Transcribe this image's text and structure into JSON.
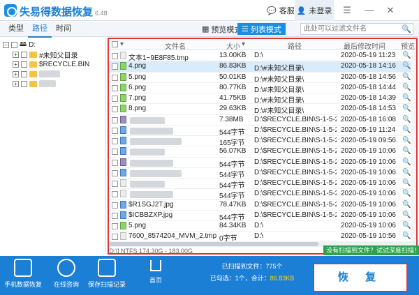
{
  "app": {
    "title": "失易得数据恢复",
    "version": "6.48"
  },
  "header": {
    "customer_service": "客服",
    "user": "未登录",
    "win_controls": [
      "☰",
      "—",
      "✕"
    ]
  },
  "toolbar": {
    "tabs": [
      "类型",
      "路径",
      "时间"
    ],
    "active_tab": "路径",
    "preview_mode": "预览模式",
    "list_mode": "列表模式",
    "search_placeholder": "此处可以过滤文件名"
  },
  "tree": {
    "drive": "D:",
    "items": [
      "#未知父目录",
      "$RECYCLE.BIN"
    ]
  },
  "table": {
    "headers": {
      "name": "文件名",
      "size": "大小",
      "path": "路径",
      "date": "最后修改时间",
      "preview": "预览"
    },
    "rows": [
      {
        "name": "文本1~9E8F85.tmp",
        "size": "13.00KB",
        "path": "D:\\",
        "date": "2020-05-19 11:23",
        "type": "tmp"
      },
      {
        "name": "4.png",
        "size": "86.83KB",
        "path": "D:\\#未知父目录\\",
        "date": "2020-05-18 14:16",
        "type": "png",
        "selected": true
      },
      {
        "name": "5.png",
        "size": "50.01KB",
        "path": "D:\\#未知父目录\\",
        "date": "2020-05-18 14:56",
        "type": "png"
      },
      {
        "name": "6.png",
        "size": "80.77KB",
        "path": "D:\\#未知父目录\\",
        "date": "2020-05-18 14:44",
        "type": "png"
      },
      {
        "name": "7.png",
        "size": "41.75KB",
        "path": "D:\\#未知父目录\\",
        "date": "2020-05-18 14:39",
        "type": "png"
      },
      {
        "name": "8.png",
        "size": "29.63KB",
        "path": "D:\\#未知父目录\\",
        "date": "2020-05-18 14:53",
        "type": "png"
      },
      {
        "name": "",
        "size": "7.38MB",
        "path": "D:\\$RECYCLE.BIN\\S-1-5-21-17...",
        "date": "2020-05-18 16:08",
        "type": "bin"
      },
      {
        "name": "",
        "size": "544字节",
        "path": "D:\\$RECYCLE.BIN\\S-1-5-21-17...",
        "date": "2020-05-19 11:24",
        "type": "c"
      },
      {
        "name": "",
        "size": "165字节",
        "path": "D:\\$RECYCLE.BIN\\S-1-5-21-17...",
        "date": "2020-05-19 09:56",
        "type": "c"
      },
      {
        "name": "",
        "size": "56.07KB",
        "path": "D:\\$RECYCLE.BIN\\S-1-5-21-17...",
        "date": "2020-05-19 10:06",
        "type": "c"
      },
      {
        "name": "",
        "size": "544字节",
        "path": "D:\\$RECYCLE.BIN\\S-1-5-21-17...",
        "date": "2020-05-19 10:06",
        "type": "bin"
      },
      {
        "name": "",
        "size": "544字节",
        "path": "D:\\$RECYCLE.BIN\\S-1-5-21-17...",
        "date": "2020-05-19 10:06",
        "type": "c"
      },
      {
        "name": "",
        "size": "544字节",
        "path": "D:\\$RECYCLE.BIN\\S-1-5-21-17...",
        "date": "2020-05-19 10:06",
        "type": "tmp"
      },
      {
        "name": "",
        "size": "544字节",
        "path": "D:\\$RECYCLE.BIN\\S-1-5-21-17...",
        "date": "2020-05-19 10:06",
        "type": "tmp"
      },
      {
        "name": "$R1SGJ2T.jpg",
        "size": "78.47KB",
        "path": "D:\\$RECYCLE.BIN\\S-1-5-21-17...",
        "date": "2020-05-19 10:06",
        "type": "c"
      },
      {
        "name": "$ICBBZXP.jpg",
        "size": "544字节",
        "path": "D:\\$RECYCLE.BIN\\S-1-5-21-17...",
        "date": "2020-05-19 10:06",
        "type": "c"
      },
      {
        "name": "5.png",
        "size": "84.34KB",
        "path": "D:\\",
        "date": "2020-05-19 10:06",
        "type": "png"
      },
      {
        "name": "7600_8574204_MVM_2.tmp",
        "size": "0字节",
        "path": "D:\\",
        "date": "2020-05-19 10:56",
        "type": "tmp"
      },
      {
        "name": "7600_8574204_MVM_2.tmp",
        "size": "",
        "path": "",
        "date": "",
        "type": "tmp"
      }
    ]
  },
  "status": {
    "drive_info": "[D:\\] NTFS 174.30G - 183.00G",
    "deep_scan": "没有扫描到文件？试试深度扫描！"
  },
  "bottom": {
    "phone_recover": "手机数据恢复",
    "consult": "在线咨询",
    "save_scan": "保存扫描记录",
    "home": "首页",
    "scanned": "已扫描到文件：775个",
    "selected_prefix": "已勾选：1个，合计：",
    "selected_size": "86.83KB",
    "recover": "恢 复"
  }
}
